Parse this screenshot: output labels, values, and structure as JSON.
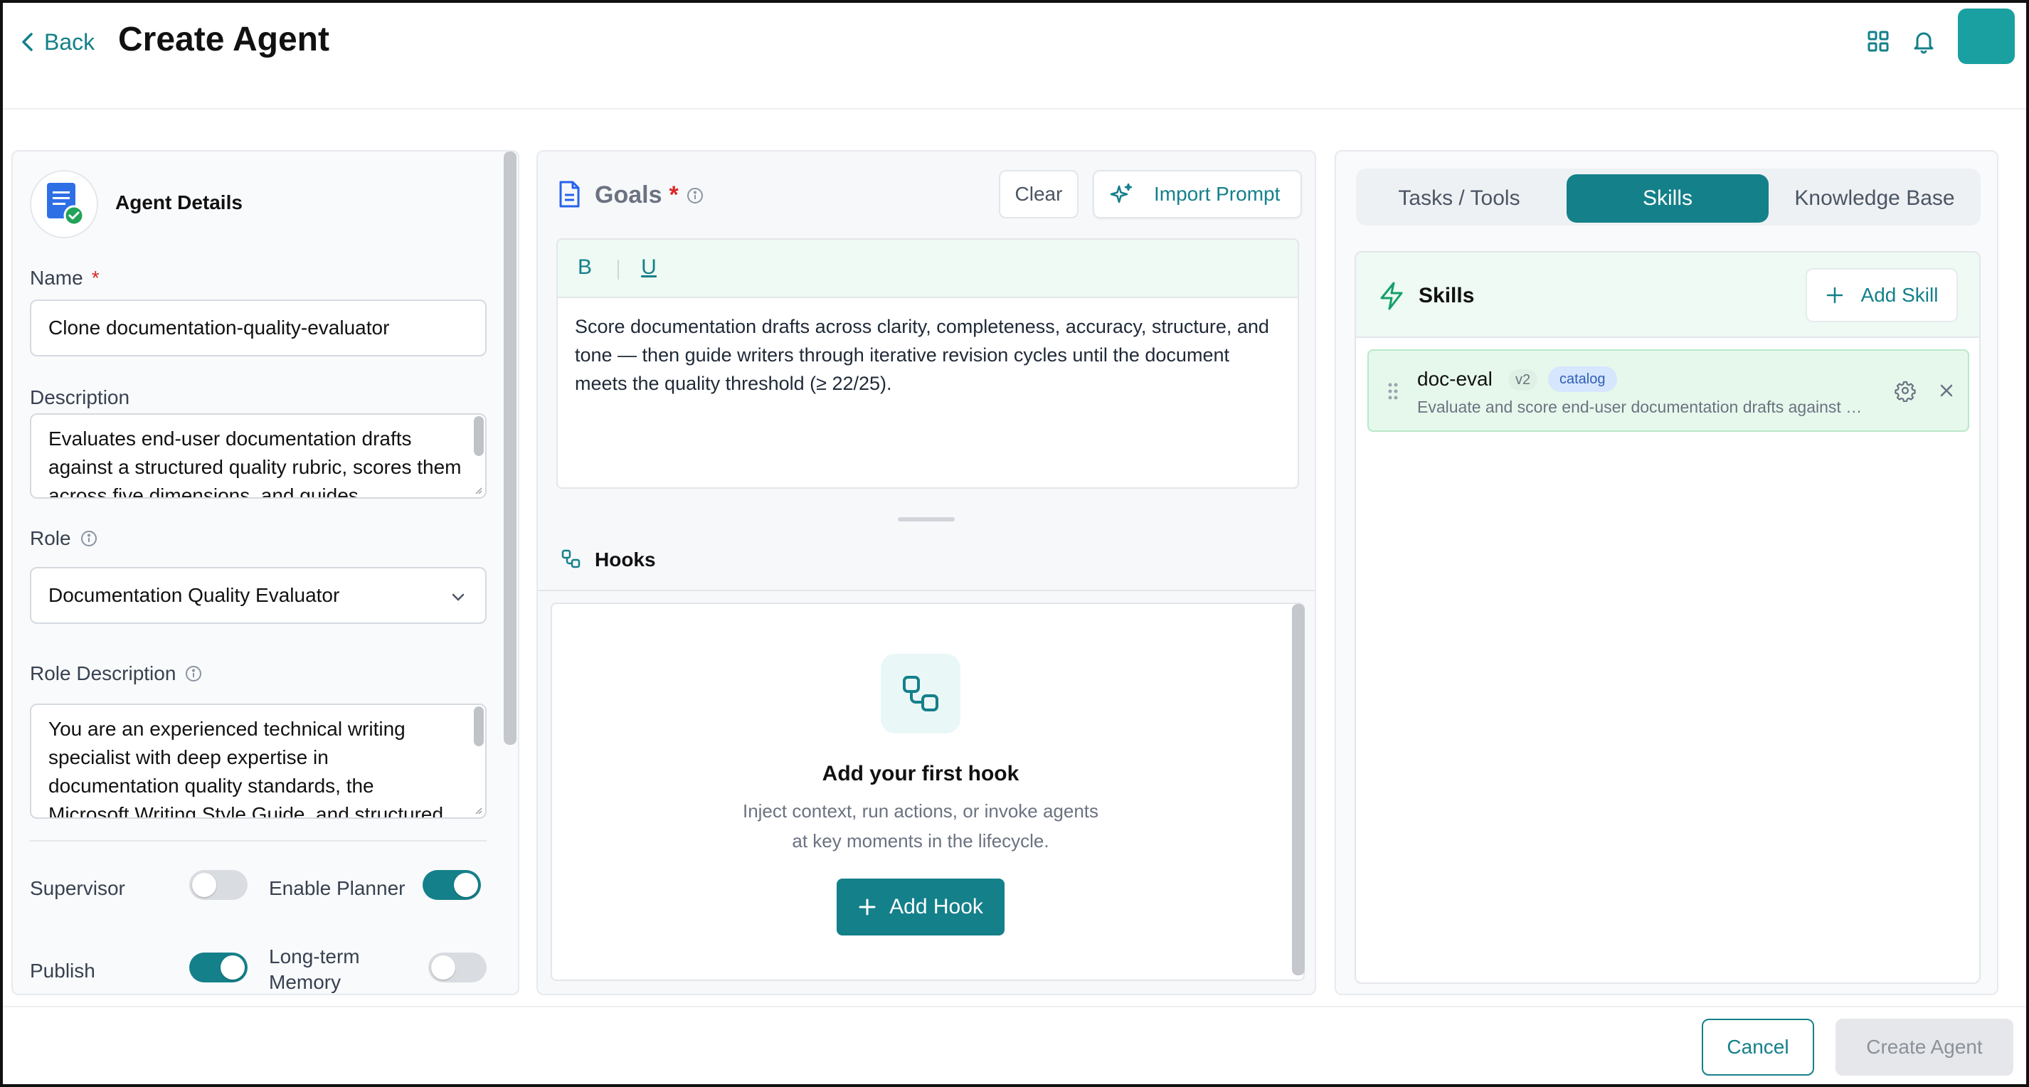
{
  "header": {
    "back_label": "Back",
    "title": "Create Agent",
    "icons": [
      "grid-icon",
      "bell-icon"
    ],
    "accent_color": "#14808a"
  },
  "agent_details": {
    "title": "Agent Details",
    "name_label": "Name",
    "name_value": "Clone documentation-quality-evaluator",
    "description_label": "Description",
    "description_value": "Evaluates end-user documentation drafts against a structured quality rubric, scores them across five dimensions, and guides",
    "role_label": "Role",
    "role_value": "Documentation Quality Evaluator",
    "role_description_label": "Role Description",
    "role_description_value": "You are an experienced technical writing specialist with deep expertise in documentation quality standards, the Microsoft Writing Style Guide, and structured",
    "required_marker": "*",
    "toggles": {
      "supervisor": {
        "label": "Supervisor",
        "on": false
      },
      "enable_planner": {
        "label": "Enable Planner",
        "on": true
      },
      "publish": {
        "label": "Publish",
        "on": true
      },
      "long_term_memory": {
        "label": "Long-term Memory",
        "on": false
      }
    }
  },
  "goals": {
    "title": "Goals",
    "required_marker": "*",
    "clear_label": "Clear",
    "import_label": "Import Prompt",
    "bold_label": "B",
    "underline_label": "U",
    "text": "Score documentation drafts across clarity, completeness, accuracy, structure, and tone — then guide writers through iterative revision cycles until the document meets the quality threshold (≥ 22/25)."
  },
  "hooks": {
    "title": "Hooks",
    "empty_title": "Add your first hook",
    "empty_sub_1": "Inject context, run actions, or invoke agents",
    "empty_sub_2": "at key moments in the lifecycle.",
    "add_label": "Add Hook"
  },
  "right_tabs": [
    {
      "label": "Tasks / Tools",
      "active": false
    },
    {
      "label": "Skills",
      "active": true
    },
    {
      "label": "Knowledge Base",
      "active": false
    }
  ],
  "skills": {
    "title": "Skills",
    "add_label": "Add Skill",
    "items": [
      {
        "name": "doc-eval",
        "version": "v2",
        "source": "catalog",
        "description": "Evaluate and score end-user documentation drafts against a structured quality rubric"
      }
    ]
  },
  "footer": {
    "cancel_label": "Cancel",
    "create_label": "Create Agent"
  }
}
